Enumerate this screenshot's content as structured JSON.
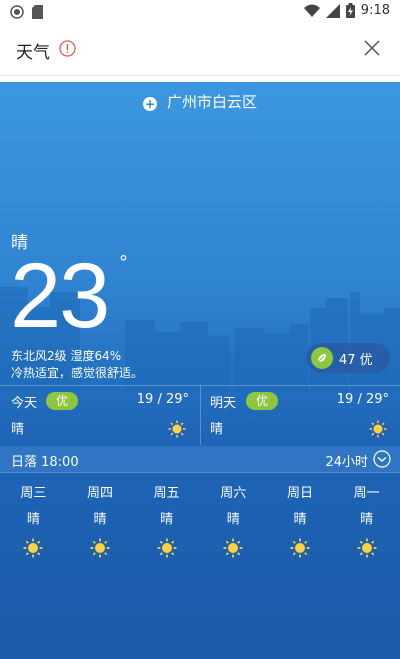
{
  "status_bar": {
    "time": "9:18"
  },
  "title_bar": {
    "title": "天气"
  },
  "weather": {
    "location": "广州市白云区",
    "condition": "晴",
    "temperature": "23",
    "degree_symbol": "°",
    "wind_humidity": "东北风2级 湿度64%",
    "comfort": "冷热适宜，感觉很舒适。",
    "aqi": "47 优",
    "today": {
      "label": "今天",
      "quality": "优",
      "range": "19 / 29°",
      "condition": "晴"
    },
    "tomorrow": {
      "label": "明天",
      "quality": "优",
      "range": "19 / 29°",
      "condition": "晴"
    },
    "sunset": "日落 18:00",
    "hours_button": "24小时",
    "forecast": [
      {
        "day": "周三",
        "condition": "晴",
        "icon": "sun-icon"
      },
      {
        "day": "周四",
        "condition": "晴",
        "icon": "sun-icon"
      },
      {
        "day": "周五",
        "condition": "晴",
        "icon": "sun-icon"
      },
      {
        "day": "周六",
        "condition": "晴",
        "icon": "sun-icon"
      },
      {
        "day": "周日",
        "condition": "晴",
        "icon": "sun-icon"
      },
      {
        "day": "周一",
        "condition": "晴",
        "icon": "sun-icon"
      }
    ]
  },
  "colors": {
    "accent_green": "#8dc63f",
    "sun": "#ffd23f",
    "warning": "#e05a4e"
  }
}
